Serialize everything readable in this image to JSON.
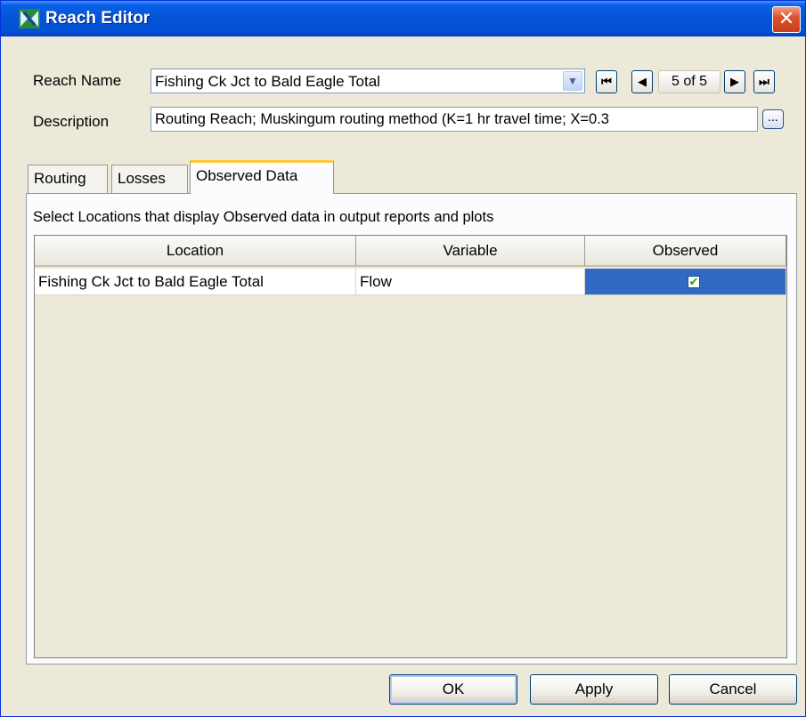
{
  "window": {
    "title": "Reach Editor",
    "close_glyph": "✕"
  },
  "form": {
    "reach_name_label": "Reach Name",
    "reach_name_value": "Fishing Ck Jct to Bald Eagle Total",
    "description_label": "Description",
    "description_value": "Routing Reach; Muskingum routing method (K=1 hr travel time; X=0.3",
    "description_button": "...",
    "nav": {
      "first": "first-icon",
      "prev": "prev-icon",
      "position": "5 of 5",
      "next": "next-icon",
      "last": "last-icon"
    }
  },
  "tabs": [
    {
      "label": "Routing",
      "active": false
    },
    {
      "label": "Losses",
      "active": false
    },
    {
      "label": "Observed Data",
      "active": true
    }
  ],
  "observed_panel": {
    "caption": "Select Locations that display Observed data in output reports and plots",
    "columns": [
      "Location",
      "Variable",
      "Observed"
    ],
    "rows": [
      {
        "location": "Fishing Ck Jct to Bald Eagle Total",
        "variable": "Flow",
        "observed": true
      }
    ]
  },
  "buttons": {
    "ok": "OK",
    "apply": "Apply",
    "cancel": "Cancel"
  },
  "colors": {
    "titlebar": "#0453d6",
    "selection": "#316ac5",
    "active_tab_accent": "#ffc83c",
    "check": "#21a121"
  }
}
